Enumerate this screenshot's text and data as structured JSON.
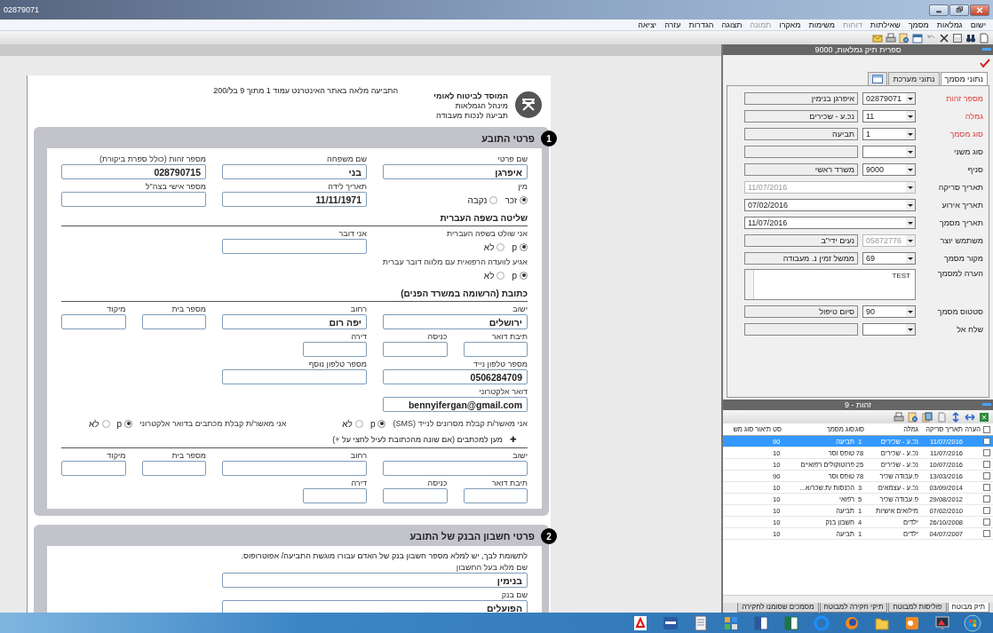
{
  "window": {
    "title": "02879071"
  },
  "menu": [
    {
      "label": "ישום",
      "disabled": false
    },
    {
      "label": "גמלאות",
      "disabled": false
    },
    {
      "label": "מסמך",
      "disabled": false
    },
    {
      "label": "שאילתות",
      "disabled": false
    },
    {
      "label": "דוחות",
      "disabled": true
    },
    {
      "label": "משימות",
      "disabled": false
    },
    {
      "label": "מאקרו",
      "disabled": false
    },
    {
      "label": "תמונה",
      "disabled": true
    },
    {
      "label": "תצוגה",
      "disabled": false
    },
    {
      "label": "הגדרות",
      "disabled": false
    },
    {
      "label": "עזרה",
      "disabled": false
    },
    {
      "label": "יציאה",
      "disabled": false
    }
  ],
  "document": {
    "org": "המוסד לביטוח לאומי",
    "department": "מינהל הגמלאות",
    "form_name": "תביעה לנכות מעבודה",
    "page_note": "התביעה מלאה באתר האינטרנט עמוד 1 מתוך 9 בל/200",
    "sections": [
      {
        "number": "1",
        "title": "פרטי התובע",
        "rows": [
          {
            "kind": "grid",
            "items": [
              {
                "kind": "long-field",
                "label": "שם פרטי",
                "value": "איפרגן"
              },
              {
                "kind": "long-field",
                "label": "שם משפחה",
                "value": "בני"
              },
              {
                "kind": "long-field",
                "label": "מספר זהות (כולל ספרת ביקורת)",
                "value": "028790715"
              }
            ]
          },
          {
            "kind": "grid",
            "items": [
              {
                "kind": "radio",
                "label": "מין",
                "options": [
                  {
                    "label": "זכר",
                    "selected": true
                  },
                  {
                    "label": "נקבה",
                    "selected": false
                  }
                ]
              },
              {
                "kind": "long-field",
                "label": "תאריך לידה",
                "value": "11/11/1971"
              },
              {
                "kind": "long-field",
                "label": "מספר אישי בצה\"ל"
              }
            ]
          },
          {
            "kind": "heading",
            "text": "שליטה בשפה העברית"
          },
          {
            "kind": "grid",
            "items": [
              {
                "kind": "radio",
                "label": "אני שולט בשפה העברית",
                "options": [
                  {
                    "label": "p",
                    "selected": true
                  },
                  {
                    "label": "לא",
                    "selected": false
                  }
                ]
              },
              {
                "kind": "long-field",
                "label": "אני דובר"
              }
            ]
          },
          {
            "kind": "grid",
            "items": [
              {
                "kind": "question",
                "label": "אגיע לוועדה הרפואית עם מלווה דובר עברית",
                "options": [
                  {
                    "label": "p",
                    "selected": true
                  },
                  {
                    "label": "לא",
                    "selected": false
                  }
                ]
              }
            ]
          },
          {
            "kind": "heading",
            "text": "כתובת (הרשומה במשרד הפנים)"
          },
          {
            "kind": "grid",
            "items": [
              {
                "kind": "long-field",
                "label": "ישוב",
                "value": "ירושלים"
              },
              {
                "kind": "long-field",
                "label": "רחוב",
                "value": "יפה רום"
              },
              {
                "kind": "short-field",
                "label": "מספר בית"
              },
              {
                "kind": "short-field",
                "label": "מיקוד"
              }
            ]
          },
          {
            "kind": "grid",
            "items": [
              {
                "kind": "short-field",
                "label": "תיבת דואר"
              },
              {
                "kind": "short-field",
                "label": "כניסה"
              },
              {
                "kind": "short-field",
                "label": "דירה"
              }
            ]
          },
          {
            "kind": "grid",
            "items": [
              {
                "kind": "long-field",
                "label": "מספר טלפון נייד",
                "value": "0506284709"
              },
              {
                "kind": "long-field",
                "label": "מספר טלפון נוסף"
              }
            ]
          },
          {
            "kind": "grid",
            "items": [
              {
                "kind": "long-field",
                "label": "דואר אלקטרוני",
                "value": "bennyifergan@gmail.com"
              }
            ]
          },
          {
            "kind": "grid",
            "items": [
              {
                "kind": "consent",
                "label": "אני מאשר/ת קבלת מסרונים לנייד (SMS)",
                "options": [
                  {
                    "label": "p",
                    "selected": true
                  },
                  {
                    "label": "לא",
                    "selected": false
                  }
                ]
              },
              {
                "kind": "consent",
                "label": "אני מאשר/ת קבלת מכתבים בדואר אלקטרוני",
                "options": [
                  {
                    "label": "p",
                    "selected": true
                  },
                  {
                    "label": "לא",
                    "selected": false
                  }
                ]
              }
            ]
          },
          {
            "kind": "expander",
            "toggle": "✚",
            "text": "מען למכתבים (אם שונה מהכתובת לעיל לחצי על +)"
          },
          {
            "kind": "grid",
            "items": [
              {
                "kind": "long-field",
                "label": "ישוב"
              },
              {
                "kind": "long-field",
                "label": "רחוב"
              },
              {
                "kind": "short-field",
                "label": "מספר בית"
              },
              {
                "kind": "short-field",
                "label": "מיקוד"
              }
            ]
          },
          {
            "kind": "grid",
            "items": [
              {
                "kind": "short-field",
                "label": "תיבת דואר"
              },
              {
                "kind": "short-field",
                "label": "כניסה"
              },
              {
                "kind": "short-field",
                "label": "דירה"
              }
            ]
          }
        ]
      },
      {
        "number": "2",
        "title": "פרטי חשבון הבנק של התובע",
        "rows": [
          {
            "kind": "note",
            "text": "לתשומת לבך, יש למלא מספר חשבון בנק של האדם עבורו מוגשת התביעה/ אפוטרופוס."
          },
          {
            "kind": "grid",
            "items": [
              {
                "kind": "wide-field",
                "label": "שם מלא בעל החשבון",
                "value": "בנימין"
              }
            ]
          },
          {
            "kind": "grid",
            "items": [
              {
                "kind": "wide-field",
                "label": "שם בנק",
                "value": "הפועלים"
              }
            ]
          }
        ]
      }
    ]
  },
  "record_panel": {
    "title": "ספרית תיק גמלאות, 9000",
    "tabs": [
      {
        "kind": "text",
        "label": "נתוני מסמך",
        "selected": true
      },
      {
        "kind": "text",
        "label": "נתוני מערכת",
        "selected": false
      },
      {
        "kind": "icon",
        "selected": false
      }
    ],
    "fields": [
      {
        "kind": "combo",
        "label": "מספר זהות",
        "required": true,
        "disabled": false,
        "code": "02879071",
        "description": "איפרגן בנימין"
      },
      {
        "kind": "combo",
        "label": "גמלה",
        "required": true,
        "disabled": false,
        "code": "11",
        "description": "נכ.ע - שכירים"
      },
      {
        "kind": "combo",
        "label": "סוג מסמך",
        "required": true,
        "disabled": false,
        "code": "1",
        "description": "תביעה"
      },
      {
        "kind": "combo",
        "label": "סוג משני",
        "required": false,
        "disabled": false
      },
      {
        "kind": "combo",
        "label": "סניף",
        "required": false,
        "disabled": false,
        "code": "9000",
        "description": "משרד ראשי"
      },
      {
        "kind": "date",
        "label": "תאריך סריקה",
        "required": false,
        "disabled": true,
        "code": "11/07/2016"
      },
      {
        "kind": "date",
        "label": "תאריך אירוע",
        "required": false,
        "disabled": false,
        "code": "07/02/2016"
      },
      {
        "kind": "date",
        "label": "תאריך מסמך",
        "required": false,
        "disabled": false,
        "code": "11/07/2016"
      },
      {
        "kind": "combo",
        "label": "משתמש יוצר",
        "required": false,
        "disabled": true,
        "code": "05872776",
        "description": "נעים ידי\"ב"
      },
      {
        "kind": "combo",
        "label": "מקור מסמך",
        "required": false,
        "disabled": false,
        "code": "69",
        "description": "ממשל זמין נ. מעבודה"
      },
      {
        "kind": "memo",
        "label": "הערה למסמך",
        "required": false,
        "disabled": false,
        "code": "TEST"
      },
      {
        "kind": "combo",
        "label": "סטטוס מסמך",
        "required": false,
        "disabled": false,
        "code": "90",
        "description": "סיום טיפול"
      },
      {
        "kind": "combo",
        "label": "שלח אל",
        "required": false,
        "disabled": false
      }
    ]
  },
  "list_panel": {
    "title": "זהות - 9",
    "all_checked": false,
    "columns": [
      "הערה",
      "תאריך סריקה",
      "גמלה",
      "סוג",
      "סוג מסמך",
      "סט",
      "תיאור סוג מש"
    ],
    "rows": [
      {
        "selected": true,
        "checked": false,
        "cells": [
          "",
          "11/07/2016",
          "נכ.ע - שכירים",
          "1",
          "תביעה",
          "90"
        ]
      },
      {
        "selected": false,
        "checked": false,
        "cells": [
          "",
          "11/07/2016",
          "נכ.ע - שכירים",
          "78",
          "טופס וסר",
          "10"
        ]
      },
      {
        "selected": false,
        "checked": false,
        "cells": [
          "",
          "10/07/2016",
          "נכ.ע - שכירים",
          "25",
          "פרוטוקולים רפואיים",
          "10"
        ]
      },
      {
        "selected": false,
        "checked": false,
        "cells": [
          "",
          "13/03/2016",
          "פ.עבודה שכיר",
          "78",
          "טופס וסר",
          "90"
        ]
      },
      {
        "selected": false,
        "checked": false,
        "cells": [
          "",
          "03/09/2014",
          "נכ.ע - עצמאים",
          "3",
          "הכנסות /ת.שכר/א...",
          "10"
        ]
      },
      {
        "selected": false,
        "checked": false,
        "cells": [
          "",
          "29/08/2012",
          "פ.עבודה שכיר",
          "5",
          "רפואי",
          "10"
        ]
      },
      {
        "selected": false,
        "checked": false,
        "cells": [
          "",
          "07/02/2010",
          "מילואים אישיות",
          "1",
          "תביעה",
          "10"
        ]
      },
      {
        "selected": false,
        "checked": false,
        "cells": [
          "",
          "26/10/2008",
          "ילדים",
          "4",
          "חשבון בנק",
          "10"
        ]
      },
      {
        "selected": false,
        "checked": false,
        "cells": [
          "",
          "04/07/2007",
          "ילדים",
          "1",
          "תביעה",
          "10"
        ]
      }
    ],
    "tabs": [
      {
        "label": "תיק מבוטח",
        "selected": true
      },
      {
        "label": "פוליסות למבוטח",
        "selected": false
      },
      {
        "label": "תיקי חקירה למבוטח",
        "selected": false
      },
      {
        "label": "מסמכים שסומנו לחקירה",
        "selected": false
      }
    ]
  }
}
